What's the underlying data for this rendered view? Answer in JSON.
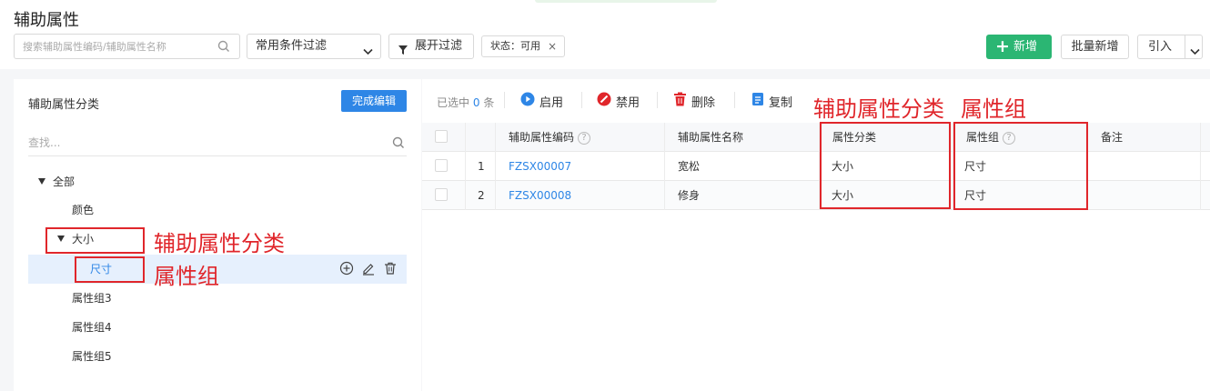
{
  "header": {
    "title": "辅助属性",
    "search_placeholder": "搜索辅助属性编码/辅助属性名称",
    "filter_select": "常用条件过滤",
    "expand_filter": "展开过滤",
    "status_tag": "状态：可用",
    "new_button": "新增",
    "batch_new_button": "批量新增",
    "import_button": "引入"
  },
  "tree": {
    "title": "辅助属性分类",
    "done_button": "完成编辑",
    "find_placeholder": "查找...",
    "nodes": {
      "all": "全部",
      "color": "颜色",
      "size": "大小",
      "dimension": "尺寸",
      "group3": "属性组3",
      "group4": "属性组4",
      "group5": "属性组5"
    }
  },
  "toolbar": {
    "selected_prefix": "已选中",
    "selected_count": "0",
    "selected_suffix": "条",
    "enable": "启用",
    "disable": "禁用",
    "delete": "删除",
    "copy": "复制"
  },
  "table": {
    "columns": {
      "code": "辅助属性编码",
      "name": "辅助属性名称",
      "category": "属性分类",
      "group": "属性组",
      "remark": "备注"
    },
    "rows": [
      {
        "index": "1",
        "code": "FZSX00007",
        "name": "宽松",
        "category": "大小",
        "group": "尺寸",
        "remark": ""
      },
      {
        "index": "2",
        "code": "FZSX00008",
        "name": "修身",
        "category": "大小",
        "group": "尺寸",
        "remark": ""
      }
    ]
  },
  "annotations": {
    "category_label": "辅助属性分类",
    "group_label": "属性组"
  },
  "colors": {
    "primary": "#2e86e6",
    "success": "#2bb673",
    "danger": "#e0262b"
  },
  "icons": {
    "search": "search-icon",
    "filter": "funnel-icon",
    "enable": "play-circle-icon",
    "disable": "ban-icon",
    "delete": "trash-icon",
    "copy": "copy-icon"
  }
}
